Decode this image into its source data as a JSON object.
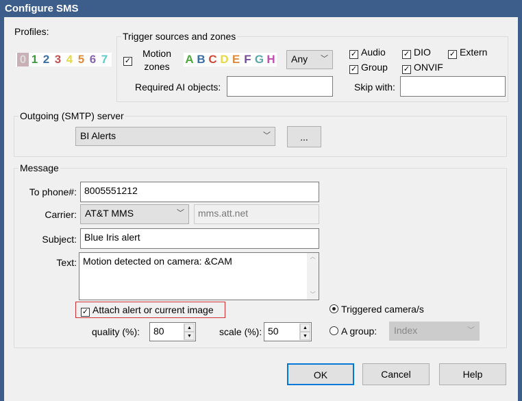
{
  "window": {
    "title": "Configure SMS"
  },
  "profiles": {
    "label": "Profiles:",
    "items": [
      {
        "t": "0",
        "c": "#c9aab2",
        "bg": "#c9b0b6"
      },
      {
        "t": "1",
        "c": "#3a9a3a"
      },
      {
        "t": "2",
        "c": "#3a6ea5"
      },
      {
        "t": "3",
        "c": "#c0504d"
      },
      {
        "t": "4",
        "c": "#e5d84a"
      },
      {
        "t": "5",
        "c": "#e08a40"
      },
      {
        "t": "6",
        "c": "#8a64a8"
      },
      {
        "t": "7",
        "c": "#5ccaca"
      }
    ]
  },
  "trigger": {
    "legend": "Trigger sources and zones",
    "motion_label_1": "Motion",
    "motion_label_2": "zones",
    "motion_checked": true,
    "zones": [
      {
        "t": "A",
        "c": "#4aaa3a"
      },
      {
        "t": "B",
        "c": "#3a6ea5"
      },
      {
        "t": "C",
        "c": "#d04a3a"
      },
      {
        "t": "D",
        "c": "#e8d84a"
      },
      {
        "t": "E",
        "c": "#e08a40"
      },
      {
        "t": "F",
        "c": "#7a4a9a"
      },
      {
        "t": "G",
        "c": "#5aa8a8"
      },
      {
        "t": "H",
        "c": "#c050b0"
      }
    ],
    "zone_mode": "Any",
    "audio": "Audio",
    "dio": "DIO",
    "extern": "Extern",
    "group": "Group",
    "onvif": "ONVIF",
    "ai_label": "Required AI objects:",
    "ai_value": "",
    "skip_label": "Skip with:",
    "skip_value": ""
  },
  "smtp": {
    "legend": "Outgoing (SMTP) server",
    "server": "BI Alerts",
    "more": "..."
  },
  "message": {
    "legend": "Message",
    "phone_label": "To phone#:",
    "phone": "8005551212",
    "carrier_label": "Carrier:",
    "carrier": "AT&T MMS",
    "gateway": "mms.att.net",
    "subject_label": "Subject:",
    "subject": "Blue Iris alert",
    "text_label": "Text:",
    "text": "Motion detected on camera: &CAM",
    "attach": "Attach alert or current image",
    "quality_label": "quality (%):",
    "quality": "80",
    "scale_label": "scale (%):",
    "scale": "50",
    "triggered": "Triggered camera/s",
    "agroup": "A group:",
    "group_value": "Index"
  },
  "buttons": {
    "ok": "OK",
    "cancel": "Cancel",
    "help": "Help"
  },
  "check": "☑"
}
